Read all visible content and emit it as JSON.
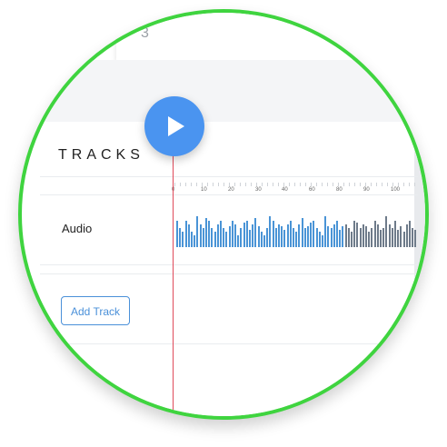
{
  "top_card": {
    "number": "3"
  },
  "tracks_header": {
    "title": "TRACKS"
  },
  "ruler": {
    "labels": [
      "0",
      "10",
      "20",
      "30",
      "40",
      "60",
      "80",
      "90",
      "100"
    ]
  },
  "tracks": [
    {
      "label": "Audio"
    }
  ],
  "add_track_button": {
    "label": "Add Track"
  },
  "colors": {
    "accent": "#4a94f0",
    "border": "#3fd43f",
    "playhead": "#e04a5a",
    "waveform_active": "#4a94d6",
    "waveform_inactive": "#6e7b8a"
  },
  "waveform": {
    "levels": [
      0.7,
      0.5,
      0.4,
      0.7,
      0.6,
      0.4,
      0.3,
      0.8,
      0.6,
      0.5,
      0.75,
      0.7,
      0.5,
      0.4,
      0.6,
      0.7,
      0.5,
      0.4,
      0.55,
      0.7,
      0.6,
      0.3,
      0.5,
      0.65,
      0.7,
      0.45,
      0.6,
      0.75,
      0.55,
      0.4,
      0.3,
      0.5,
      0.8,
      0.7,
      0.5,
      0.6,
      0.55,
      0.45,
      0.6,
      0.7,
      0.5,
      0.4,
      0.6,
      0.75,
      0.5,
      0.55,
      0.65,
      0.7,
      0.5,
      0.4,
      0.3,
      0.8,
      0.55,
      0.5,
      0.6,
      0.7,
      0.45,
      0.55,
      0.6,
      0.5,
      0.4,
      0.7,
      0.65,
      0.5,
      0.6,
      0.55,
      0.4,
      0.5,
      0.7,
      0.6,
      0.45,
      0.5,
      0.8,
      0.6,
      0.5,
      0.7,
      0.45,
      0.55,
      0.4,
      0.6,
      0.7,
      0.5,
      0.45
    ],
    "played_fraction": 0.7
  }
}
